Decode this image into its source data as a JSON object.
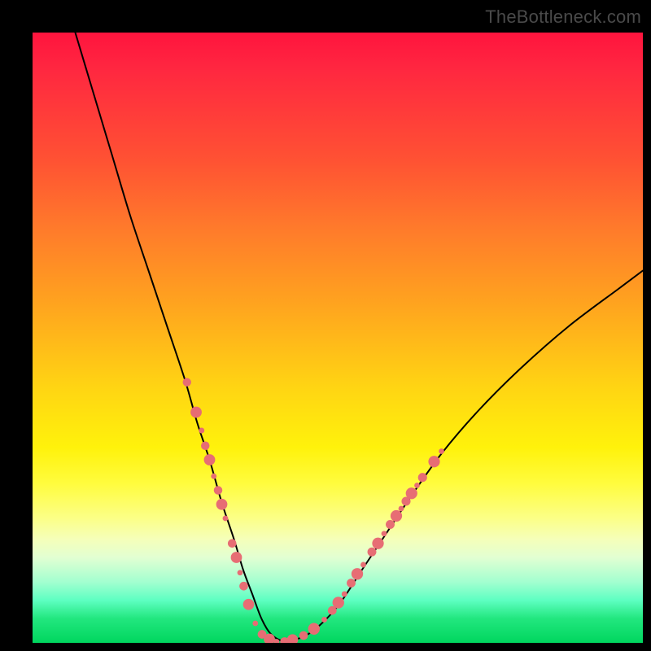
{
  "watermark": "TheBottleneck.com",
  "chart_data": {
    "type": "line",
    "title": "",
    "xlabel": "",
    "ylabel": "",
    "xlim": [
      0,
      100
    ],
    "ylim": [
      0,
      100
    ],
    "grid": false,
    "legend": false,
    "background_gradient": {
      "direction": "vertical",
      "stops": [
        {
          "pos": 0,
          "color": "#ff143e"
        },
        {
          "pos": 50,
          "color": "#ffc015"
        },
        {
          "pos": 75,
          "color": "#fcff6e"
        },
        {
          "pos": 100,
          "color": "#00d65e"
        }
      ]
    },
    "series": [
      {
        "name": "bottleneck-curve",
        "color": "#000000",
        "stroke_width": 2,
        "x": [
          7,
          10,
          13,
          16,
          19,
          22,
          25,
          27,
          29,
          31,
          33,
          34.5,
          36,
          37.5,
          39,
          41,
          43,
          46,
          50,
          54,
          58,
          62,
          67,
          73,
          80,
          88,
          96,
          100
        ],
        "y": [
          100,
          90,
          80,
          70,
          61,
          52,
          43,
          36,
          30,
          23,
          17,
          12,
          8,
          4,
          1.5,
          0.3,
          0.5,
          2,
          6,
          12,
          18,
          24,
          31,
          38,
          45,
          52,
          58,
          61
        ]
      }
    ],
    "markers": [
      {
        "name": "left-beads",
        "color": "#e76d74",
        "radius_range": [
          3.2,
          7.2
        ],
        "points": [
          {
            "x": 25.3,
            "y": 42.7
          },
          {
            "x": 26.8,
            "y": 37.8
          },
          {
            "x": 27.7,
            "y": 34.8
          },
          {
            "x": 28.3,
            "y": 32.3
          },
          {
            "x": 29.0,
            "y": 30.0
          },
          {
            "x": 29.7,
            "y": 27.3
          },
          {
            "x": 30.4,
            "y": 25.0
          },
          {
            "x": 31.0,
            "y": 22.7
          },
          {
            "x": 31.6,
            "y": 20.4
          },
          {
            "x": 32.7,
            "y": 16.3
          },
          {
            "x": 33.4,
            "y": 14.0
          },
          {
            "x": 34.0,
            "y": 11.5
          },
          {
            "x": 34.6,
            "y": 9.3
          },
          {
            "x": 35.4,
            "y": 6.3
          },
          {
            "x": 36.5,
            "y": 3.2
          },
          {
            "x": 37.6,
            "y": 1.4
          },
          {
            "x": 38.8,
            "y": 0.6
          },
          {
            "x": 40.0,
            "y": 0.2
          },
          {
            "x": 41.3,
            "y": 0.2
          },
          {
            "x": 42.6,
            "y": 0.5
          }
        ]
      },
      {
        "name": "right-beads",
        "color": "#e76d74",
        "radius_range": [
          3.2,
          7.5
        ],
        "points": [
          {
            "x": 44.4,
            "y": 1.2
          },
          {
            "x": 46.1,
            "y": 2.3
          },
          {
            "x": 47.8,
            "y": 3.8
          },
          {
            "x": 49.1,
            "y": 5.3
          },
          {
            "x": 50.1,
            "y": 6.6
          },
          {
            "x": 51.1,
            "y": 8.0
          },
          {
            "x": 52.2,
            "y": 9.8
          },
          {
            "x": 53.2,
            "y": 11.3
          },
          {
            "x": 54.2,
            "y": 12.8
          },
          {
            "x": 55.6,
            "y": 14.9
          },
          {
            "x": 56.6,
            "y": 16.3
          },
          {
            "x": 57.6,
            "y": 17.9
          },
          {
            "x": 58.6,
            "y": 19.4
          },
          {
            "x": 59.6,
            "y": 20.8
          },
          {
            "x": 60.4,
            "y": 22.0
          },
          {
            "x": 61.2,
            "y": 23.2
          },
          {
            "x": 62.1,
            "y": 24.5
          },
          {
            "x": 63.0,
            "y": 25.8
          },
          {
            "x": 63.9,
            "y": 27.1
          },
          {
            "x": 65.8,
            "y": 29.7
          },
          {
            "x": 67.0,
            "y": 31.4
          }
        ]
      }
    ]
  }
}
